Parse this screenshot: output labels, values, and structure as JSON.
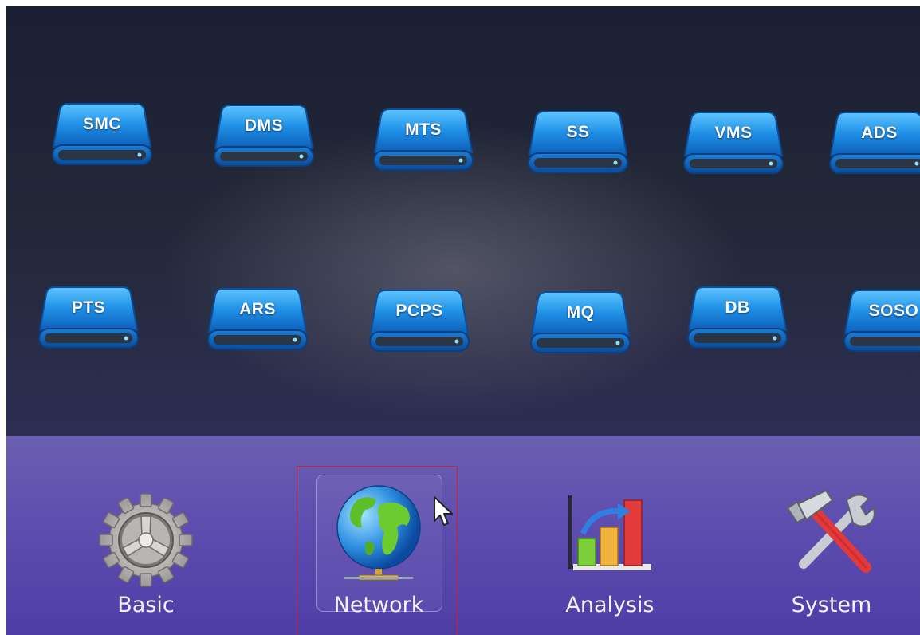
{
  "services": {
    "row1": [
      {
        "label": "SMC"
      },
      {
        "label": "DMS"
      },
      {
        "label": "MTS"
      },
      {
        "label": "SS"
      },
      {
        "label": "VMS"
      },
      {
        "label": "ADS"
      }
    ],
    "row2": [
      {
        "label": "PTS"
      },
      {
        "label": "ARS"
      },
      {
        "label": "PCPS"
      },
      {
        "label": "MQ"
      },
      {
        "label": "DB"
      },
      {
        "label": "SOSO"
      }
    ]
  },
  "dock": {
    "items": [
      {
        "label": "Basic",
        "icon": "gear-icon"
      },
      {
        "label": "Network",
        "icon": "globe-icon",
        "selected": true
      },
      {
        "label": "Analysis",
        "icon": "bar-chart-icon"
      },
      {
        "label": "System",
        "icon": "tools-icon"
      }
    ]
  },
  "colors": {
    "drive_blue": "#1f8fe6",
    "selection_outline": "#d0202a",
    "dock_bg": "#5f4fb0"
  }
}
